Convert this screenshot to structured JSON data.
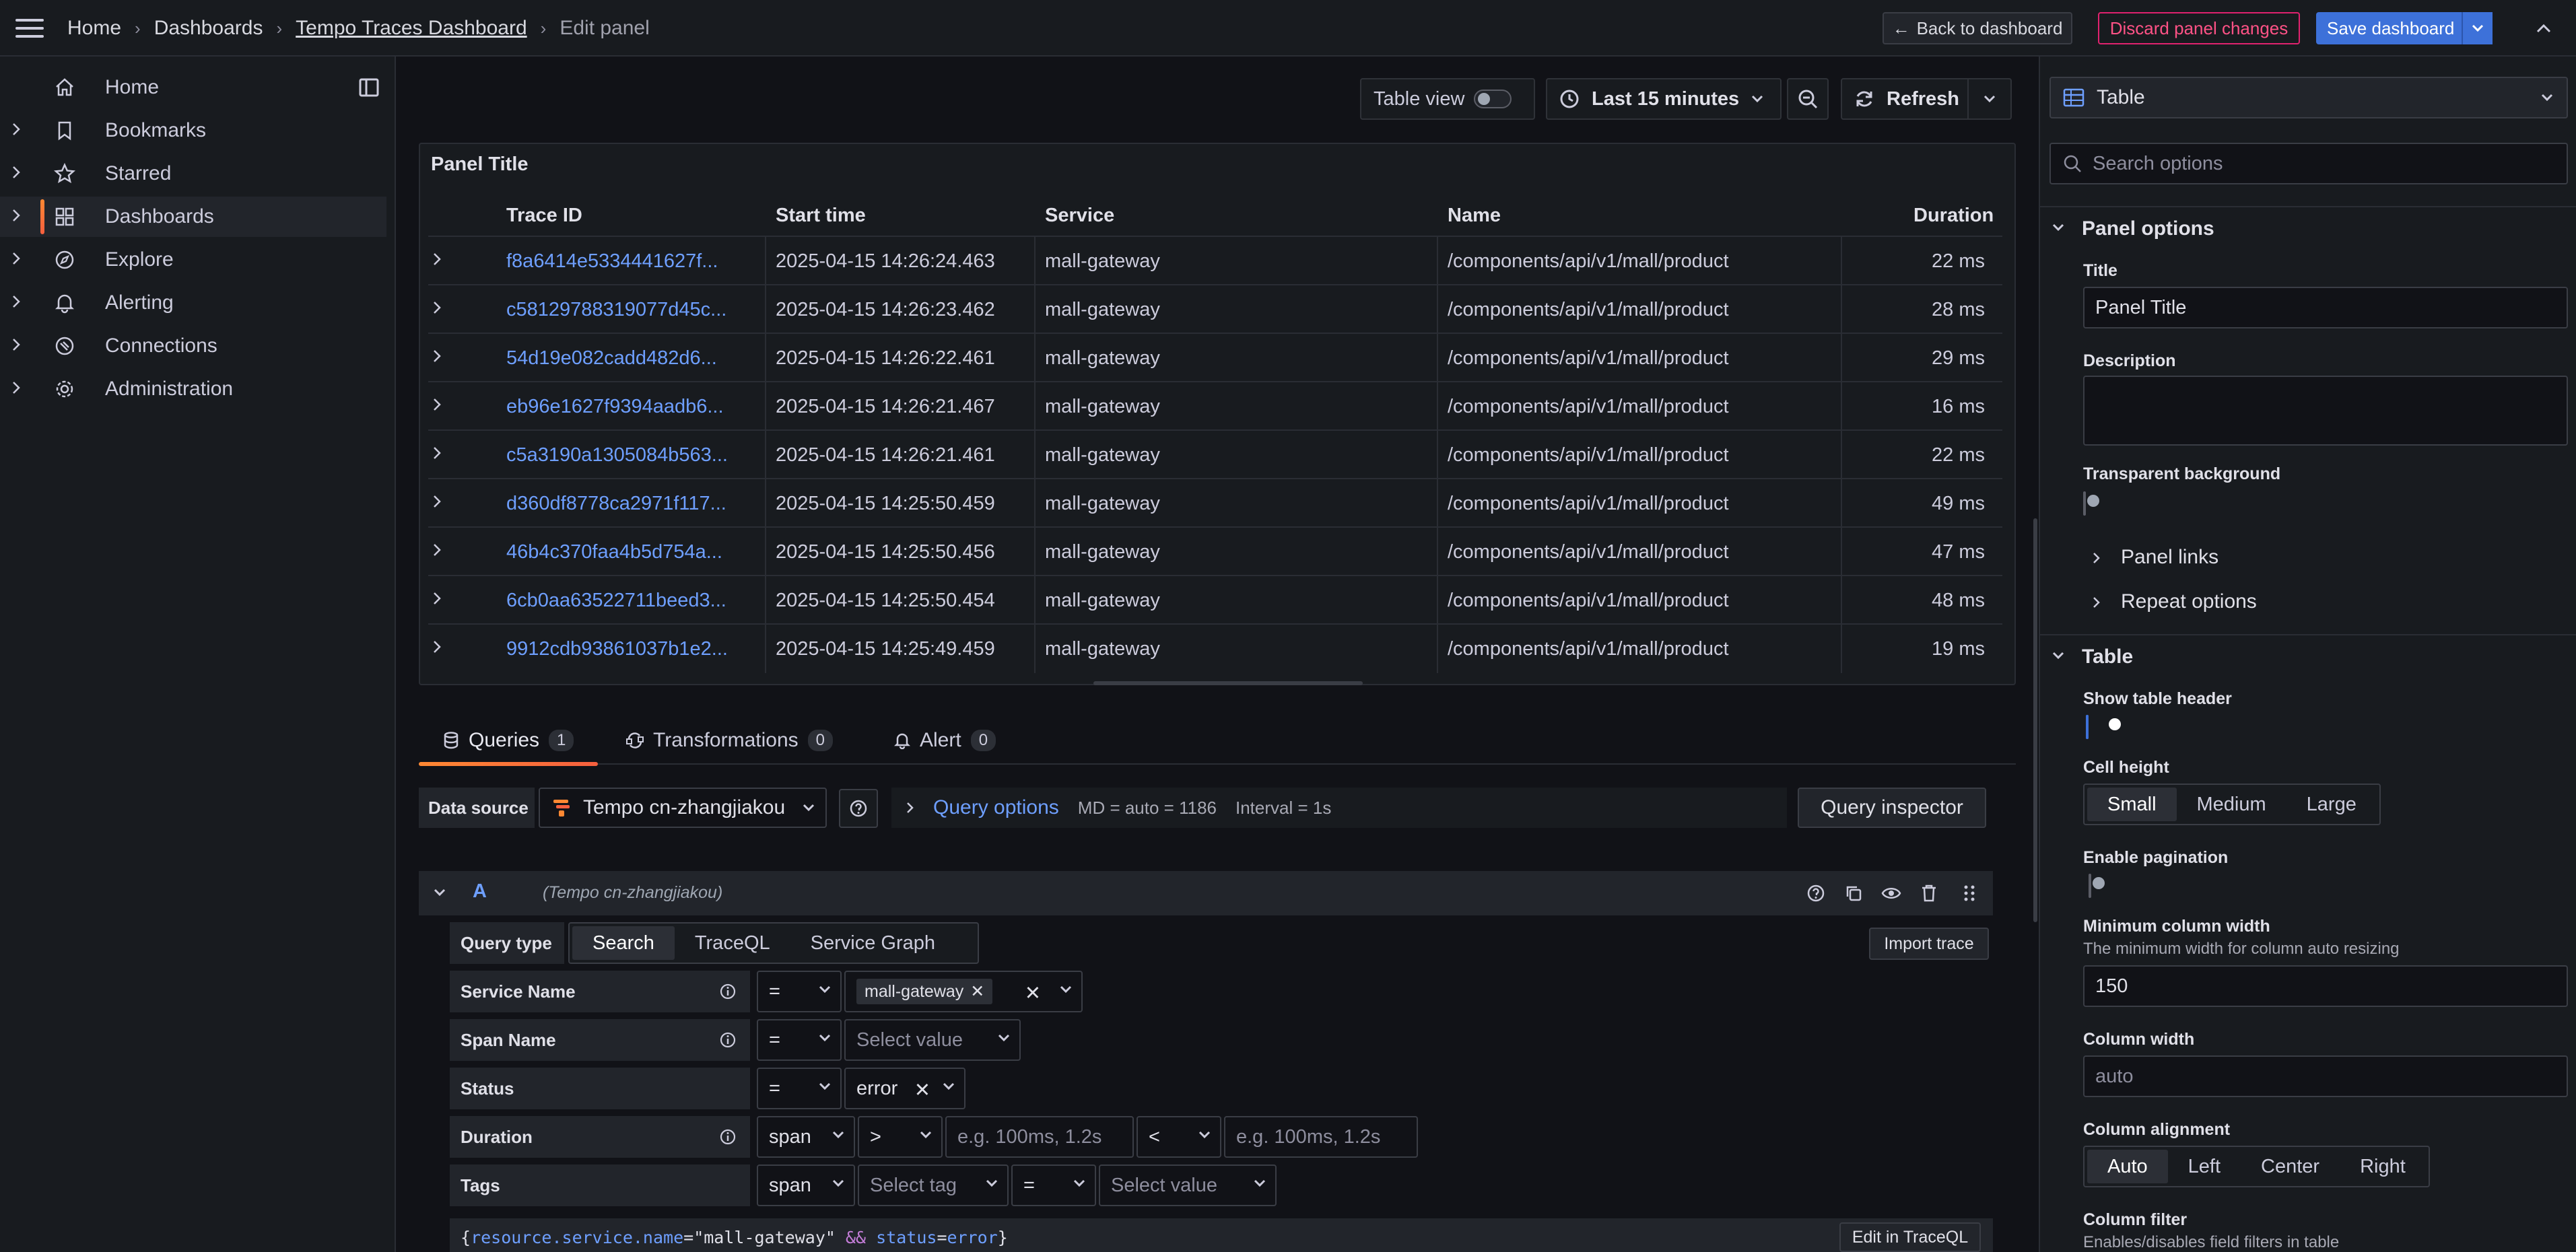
{
  "topbar": {
    "breadcrumb": [
      "Home",
      "Dashboards",
      "Tempo Traces Dashboard",
      "Edit panel"
    ],
    "back_label": "Back to dashboard",
    "discard_label": "Discard panel changes",
    "save_label": "Save dashboard"
  },
  "nav": {
    "items": [
      {
        "label": "Home",
        "icon": "home-icon"
      },
      {
        "label": "Bookmarks",
        "icon": "bookmark-icon"
      },
      {
        "label": "Starred",
        "icon": "star-icon"
      },
      {
        "label": "Dashboards",
        "icon": "apps-icon"
      },
      {
        "label": "Explore",
        "icon": "compass-icon"
      },
      {
        "label": "Alerting",
        "icon": "bell-icon"
      },
      {
        "label": "Connections",
        "icon": "plug-icon"
      },
      {
        "label": "Administration",
        "icon": "cog-icon"
      }
    ],
    "active": "Dashboards",
    "accent": "#ff8833"
  },
  "toolbar": {
    "table_view_label": "Table view",
    "time_range": "Last 15 minutes",
    "refresh_label": "Refresh"
  },
  "panel": {
    "title": "Panel Title",
    "columns": [
      "Trace ID",
      "Start time",
      "Service",
      "Name",
      "Duration"
    ],
    "rows": [
      {
        "trace_id": "f8a6414e5334441627f...",
        "start": "2025-04-15 14:26:24.463",
        "service": "mall-gateway",
        "name": "/components/api/v1/mall/product",
        "duration": "22 ms"
      },
      {
        "trace_id": "c58129788319077d45c...",
        "start": "2025-04-15 14:26:23.462",
        "service": "mall-gateway",
        "name": "/components/api/v1/mall/product",
        "duration": "28 ms"
      },
      {
        "trace_id": "54d19e082cadd482d6...",
        "start": "2025-04-15 14:26:22.461",
        "service": "mall-gateway",
        "name": "/components/api/v1/mall/product",
        "duration": "29 ms"
      },
      {
        "trace_id": "eb96e1627f9394aadb6...",
        "start": "2025-04-15 14:26:21.467",
        "service": "mall-gateway",
        "name": "/components/api/v1/mall/product",
        "duration": "16 ms"
      },
      {
        "trace_id": "c5a3190a1305084b563...",
        "start": "2025-04-15 14:26:21.461",
        "service": "mall-gateway",
        "name": "/components/api/v1/mall/product",
        "duration": "22 ms"
      },
      {
        "trace_id": "d360df8778ca2971f117...",
        "start": "2025-04-15 14:25:50.459",
        "service": "mall-gateway",
        "name": "/components/api/v1/mall/product",
        "duration": "49 ms"
      },
      {
        "trace_id": "46b4c370faa4b5d754a...",
        "start": "2025-04-15 14:25:50.456",
        "service": "mall-gateway",
        "name": "/components/api/v1/mall/product",
        "duration": "47 ms"
      },
      {
        "trace_id": "6cb0aa63522711beed3...",
        "start": "2025-04-15 14:25:50.454",
        "service": "mall-gateway",
        "name": "/components/api/v1/mall/product",
        "duration": "48 ms"
      },
      {
        "trace_id": "9912cdb93861037b1e2...",
        "start": "2025-04-15 14:25:49.459",
        "service": "mall-gateway",
        "name": "/components/api/v1/mall/product",
        "duration": "19 ms"
      }
    ]
  },
  "tabs": [
    {
      "label": "Queries",
      "count": "1"
    },
    {
      "label": "Transformations",
      "count": "0"
    },
    {
      "label": "Alert",
      "count": "0"
    }
  ],
  "datasource": {
    "label": "Data source",
    "value": "Tempo cn-zhangjiakou",
    "query_options_label": "Query options",
    "md": "MD = auto = 1186",
    "interval": "Interval = 1s",
    "inspector_label": "Query inspector"
  },
  "query_a": {
    "letter": "A",
    "ds": "(Tempo cn-zhangjiakou)",
    "query_type_label": "Query type",
    "query_types": [
      "Search",
      "TraceQL",
      "Service Graph"
    ],
    "query_type_active": "Search",
    "import_label": "Import trace",
    "service_name_label": "Service Name",
    "service_op": "=",
    "service_value": "mall-gateway",
    "span_name_label": "Span Name",
    "span_op": "=",
    "span_placeholder": "Select value",
    "status_label": "Status",
    "status_op": "=",
    "status_value": "error",
    "duration_label": "Duration",
    "duration_scope": "span",
    "duration_op1": ">",
    "duration_ph1": "e.g. 100ms, 1.2s",
    "duration_op2": "<",
    "duration_ph2": "e.g. 100ms, 1.2s",
    "tags_label": "Tags",
    "tags_scope": "span",
    "tags_placeholder": "Select tag",
    "tags_op": "=",
    "tags_value_placeholder": "Select value",
    "traceql_preview": {
      "open": "{",
      "key1": "resource.service.name",
      "eq1": "=",
      "val1": "\"mall-gateway\"",
      "and": "&&",
      "key2": "status",
      "eq2": "=",
      "val2": "error",
      "close": "}"
    },
    "edit_traceql_label": "Edit in TraceQL"
  },
  "options": {
    "viz": "Table",
    "search_placeholder": "Search options",
    "panel_options_title": "Panel options",
    "title_label": "Title",
    "title_value": "Panel Title",
    "description_label": "Description",
    "transparent_label": "Transparent background",
    "panel_links_label": "Panel links",
    "repeat_options_label": "Repeat options",
    "table_section_title": "Table",
    "show_header_label": "Show table header",
    "cell_height_label": "Cell height",
    "cell_heights": [
      "Small",
      "Medium",
      "Large"
    ],
    "cell_height_active": "Small",
    "pagination_label": "Enable pagination",
    "min_col_width_label": "Minimum column width",
    "min_col_width_desc": "The minimum width for column auto resizing",
    "min_col_width_value": "150",
    "col_width_label": "Column width",
    "col_width_placeholder": "auto",
    "col_align_label": "Column alignment",
    "col_aligns": [
      "Auto",
      "Left",
      "Center",
      "Right"
    ],
    "col_align_active": "Auto",
    "col_filter_label": "Column filter",
    "col_filter_desc": "Enables/disables field filters in table"
  },
  "colors": {
    "bg": "#111217",
    "panel": "#181b1f",
    "link": "#6e9fff",
    "primary": "#3d71d9",
    "danger": "#ff5286"
  }
}
